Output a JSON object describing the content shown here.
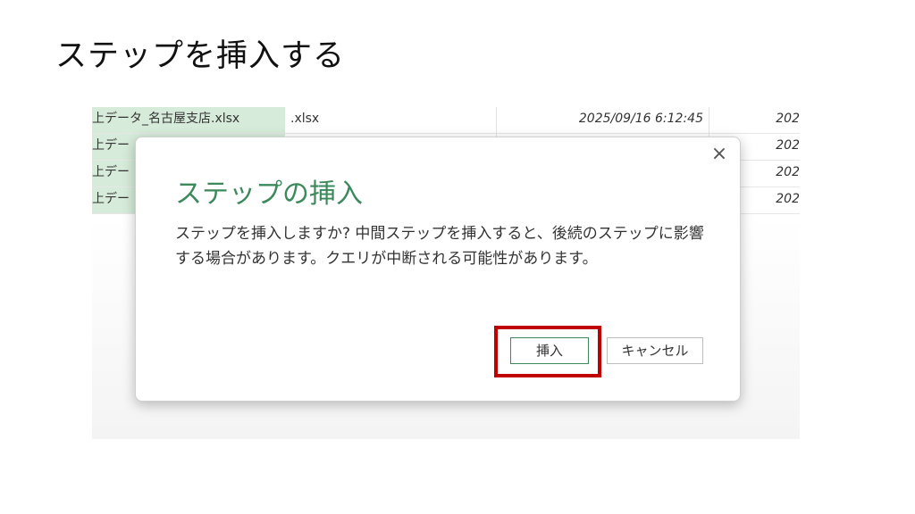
{
  "slide_title": "ステップを挿入する",
  "table_rows": [
    {
      "name": "上データ_名古屋支店.xlsx",
      "ext": ".xlsx",
      "date": "2025/09/16 6:12:45",
      "date2": "202"
    },
    {
      "name": "上デー",
      "ext": "",
      "date": "",
      "date2": "202"
    },
    {
      "name": "上デー",
      "ext": "",
      "date": "",
      "date2": "202"
    },
    {
      "name": "上デー",
      "ext": "",
      "date": "",
      "date2": "202"
    }
  ],
  "dialog": {
    "title": "ステップの挿入",
    "message": "ステップを挿入しますか? 中間ステップを挿入すると、後続のステップに影響する場合があります。クエリが中断される可能性があります。",
    "insert_label": "挿入",
    "cancel_label": "キャンセル",
    "close_glyph": "×"
  },
  "colors": {
    "accent_green": "#3c8a5c",
    "highlight_red": "#c00000",
    "name_cell_bg": "#d6ebd9"
  },
  "icons": {
    "close": "close-icon"
  }
}
